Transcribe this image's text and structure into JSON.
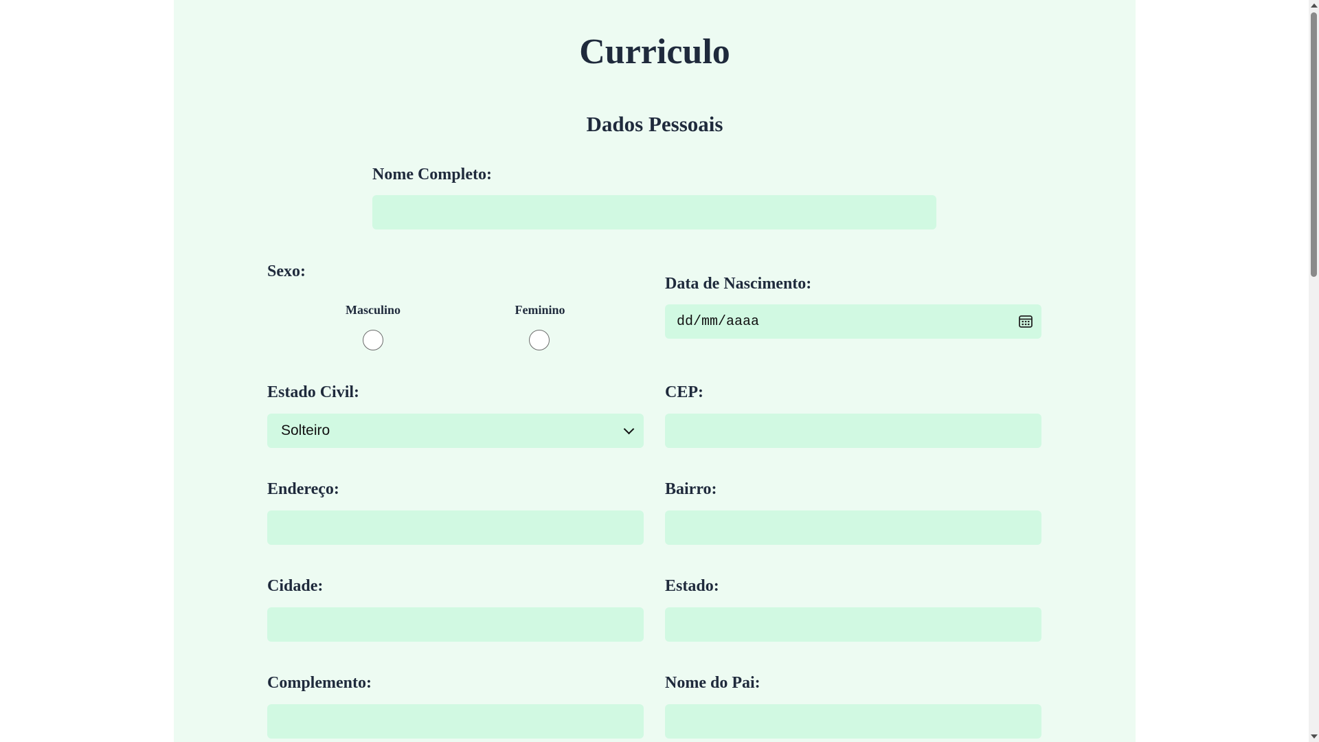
{
  "page": {
    "title": "Curriculo",
    "section_title": "Dados Pessoais"
  },
  "form": {
    "nome_completo": {
      "label": "Nome Completo:",
      "value": ""
    },
    "sexo": {
      "label": "Sexo:",
      "options": [
        {
          "label": "Masculino",
          "checked": false
        },
        {
          "label": "Feminino",
          "checked": false
        }
      ]
    },
    "data_nascimento": {
      "label": "Data de Nascimento:",
      "placeholder": "dd/mm/aaaa",
      "icon": "calendar-icon"
    },
    "estado_civil": {
      "label": "Estado Civil:",
      "selected": "Solteiro",
      "icon": "chevron-down-icon"
    },
    "cep": {
      "label": "CEP:",
      "value": ""
    },
    "endereco": {
      "label": "Endereço:",
      "value": ""
    },
    "bairro": {
      "label": "Bairro:",
      "value": ""
    },
    "cidade": {
      "label": "Cidade:",
      "value": ""
    },
    "estado": {
      "label": "Estado:",
      "value": ""
    },
    "complemento": {
      "label": "Complemento:",
      "value": ""
    },
    "nome_pai": {
      "label": "Nome do Pai:",
      "value": ""
    }
  },
  "colors": {
    "page_background": "#edfbf2",
    "field_background": "#d1f9e2",
    "text": "#1f2a3c"
  }
}
